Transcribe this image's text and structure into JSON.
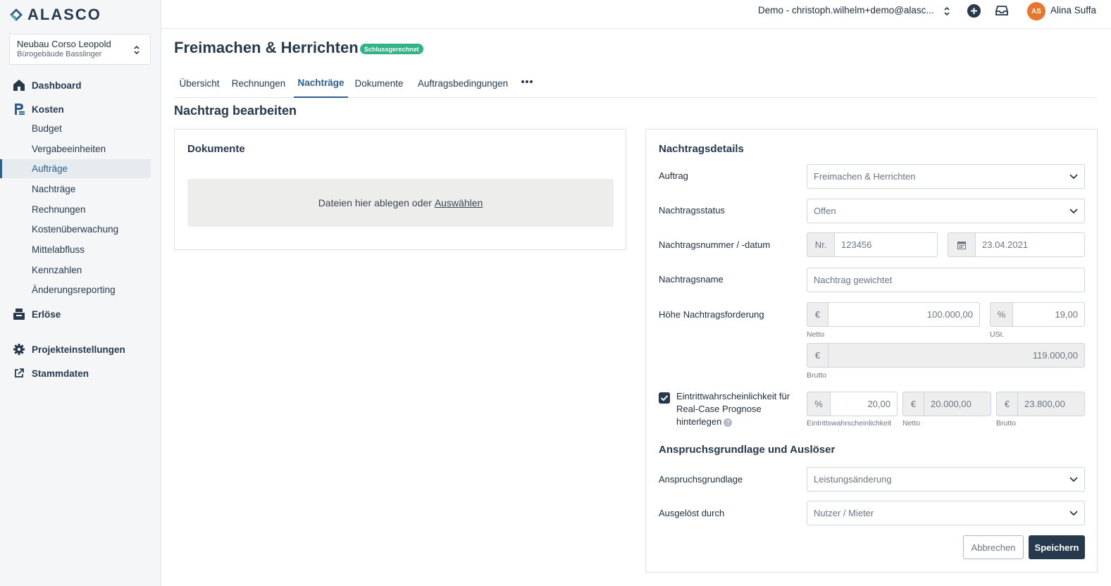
{
  "brand": {
    "name": "ALASCO"
  },
  "project": {
    "name": "Neubau Corso Leopold",
    "building": "Bürogebäude Basslinger"
  },
  "sidebar": {
    "dashboard": "Dashboard",
    "kosten": "Kosten",
    "kosten_items": [
      "Budget",
      "Vergabeeinheiten",
      "Aufträge",
      "Nachträge",
      "Rechnungen",
      "Kostenüberwachung",
      "Mittelabfluss",
      "Kennzahlen",
      "Änderungsreporting"
    ],
    "active_item": "Aufträge",
    "erloese": "Erlöse",
    "projekteinstellungen": "Projekteinstellungen",
    "stammdaten": "Stammdaten"
  },
  "header": {
    "tenant": "Demo - christoph.wilhelm+demo@alasc...",
    "avatar_initials": "AS",
    "user_name": "Alina Suffa"
  },
  "page": {
    "title": "Freimachen & Herrichten",
    "status": "Schlussgerechnet",
    "tabs": [
      "Übersicht",
      "Rechnungen",
      "Nachträge",
      "Dokumente",
      "Auftragsbedingungen"
    ],
    "active_tab": "Nachträge",
    "section_title": "Nachtrag bearbeiten"
  },
  "documents": {
    "title": "Dokumente",
    "drop_text": "Dateien hier ablegen oder",
    "select_link": "Auswählen"
  },
  "details": {
    "title": "Nachtragsdetails",
    "auftrag_label": "Auftrag",
    "auftrag_value": "Freimachen & Herrichten",
    "status_label": "Nachtragsstatus",
    "status_value": "Offen",
    "number_label": "Nachtragsnummer / -datum",
    "number_prefix": "Nr.",
    "number_value": "123456",
    "date_value": "23.04.2021",
    "name_label": "Nachtragsname",
    "name_placeholder": "Nachtrag gewichtet",
    "amount_label": "Höhe Nachtragsforderung",
    "currency": "€",
    "percent": "%",
    "netto_value": "100.000,00",
    "netto_hint": "Netto",
    "ust_value": "19,00",
    "ust_hint": "USt.",
    "brutto_value": "119.000,00",
    "brutto_hint": "Brutto",
    "probability_label": "Eintrittwahrscheinlichkeit für Real-Case Prognose hinterlegen",
    "probability_checked": true,
    "probability_value": "20,00",
    "probability_hint": "Eintrittswahrscheinlichkeit",
    "prob_netto_value": "20.000,00",
    "prob_netto_hint": "Netto",
    "prob_brutto_value": "23.800,00",
    "prob_brutto_hint": "Brutto"
  },
  "claim": {
    "title": "Anspruchsgrundlage und Auslöser",
    "basis_label": "Anspruchsgrundlage",
    "basis_value": "Leistungsänderung",
    "trigger_label": "Ausgelöst durch",
    "trigger_value": "Nutzer / Mieter"
  },
  "actions": {
    "cancel": "Abbrechen",
    "save": "Speichern"
  },
  "colors": {
    "brand": "#26394d",
    "accent": "#2c5f8a",
    "status": "#2fb387",
    "avatar": "#e8762b"
  }
}
